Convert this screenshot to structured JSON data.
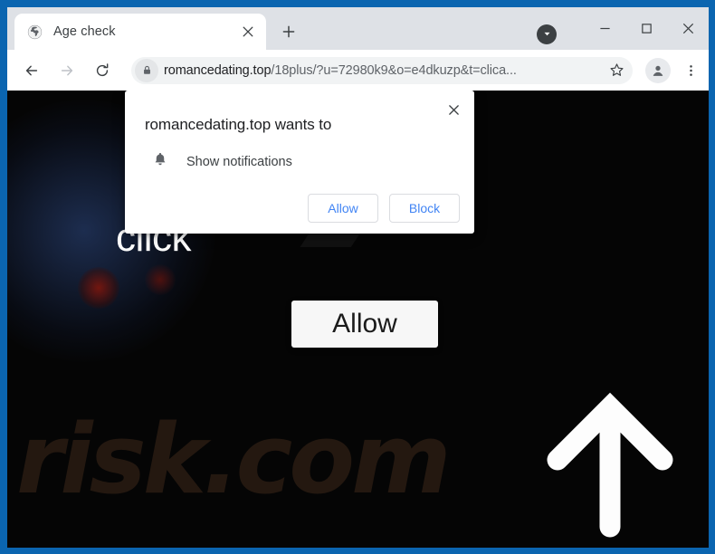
{
  "window": {
    "frame_color": "#0b65b0",
    "chrome_bg": "#dee1e6"
  },
  "tab_strip": {
    "tabs": [
      {
        "title": "Age check",
        "favicon": "globe-icon",
        "active": true
      }
    ],
    "close_label": "×",
    "new_tab_label": "+",
    "download_indicator": "download-chevron-icon",
    "window_controls": {
      "minimize": "minimize-icon",
      "maximize": "maximize-icon",
      "close": "close-icon"
    }
  },
  "toolbar": {
    "back": "back-arrow-icon",
    "forward": "forward-arrow-icon",
    "reload": "reload-icon",
    "lock": "lock-icon",
    "url_host": "romancedating.top",
    "url_path": "/18plus/?u=72980k9&o=e4dkuzp&t=clica...",
    "url_full": "romancedating.top/18plus/?u=72980k9&o=e4dkuzp&t=clica...",
    "bookmark": "star-icon",
    "profile": "avatar-icon",
    "menu": "three-dot-menu-icon"
  },
  "page": {
    "background_color": "#050505",
    "headline_visible_text": "click",
    "allow_button_label": "Allow",
    "arrow": "up-arrow-icon",
    "watermark_slash": "7",
    "watermark_word": "risk.com"
  },
  "permission_bubble": {
    "title": "romancedating.top wants to",
    "close_label": "×",
    "permission_icon": "bell-icon",
    "permission_label": "Show notifications",
    "allow_label": "Allow",
    "block_label": "Block",
    "accent_color": "#4285f4"
  }
}
